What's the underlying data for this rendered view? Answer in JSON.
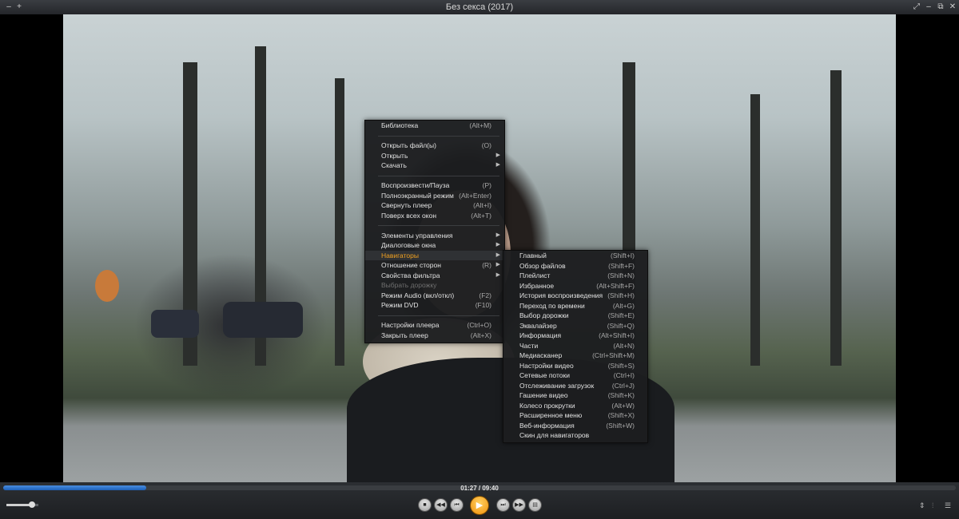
{
  "window": {
    "title": "Без секса (2017)",
    "left_buttons": [
      "–",
      "+"
    ],
    "right_buttons": [
      "⤢",
      "–",
      "⧉",
      "✕"
    ]
  },
  "main_menu": [
    {
      "label": "Библиотека",
      "shortcut": "(Alt+M)"
    },
    {
      "separator": true
    },
    {
      "label": "Открыть файл(ы)",
      "shortcut": "(O)"
    },
    {
      "label": "Открыть",
      "submenu": true
    },
    {
      "label": "Скачать",
      "submenu": true
    },
    {
      "separator": true
    },
    {
      "label": "Воспроизвести/Пауза",
      "shortcut": "(P)"
    },
    {
      "label": "Полноэкранный режим",
      "shortcut": "(Alt+Enter)"
    },
    {
      "label": "Свернуть плеер",
      "shortcut": "(Alt+I)"
    },
    {
      "label": "Поверх всех окон",
      "shortcut": "(Alt+T)"
    },
    {
      "separator": true
    },
    {
      "label": "Элементы управления",
      "submenu": true
    },
    {
      "label": "Диалоговые окна",
      "submenu": true
    },
    {
      "label": "Навигаторы",
      "submenu": true,
      "active": true
    },
    {
      "label": "Отношение сторон",
      "shortcut": "(R)",
      "submenu": true
    },
    {
      "label": "Свойства фильтра",
      "submenu": true
    },
    {
      "label": "Выбрать дорожку",
      "disabled": true
    },
    {
      "label": "Режим Audio (вкл/откл)",
      "shortcut": "(F2)"
    },
    {
      "label": "Режим DVD",
      "shortcut": "(F10)"
    },
    {
      "separator": true
    },
    {
      "label": "Настройки плеера",
      "shortcut": "(Ctrl+O)"
    },
    {
      "label": "Закрыть плеер",
      "shortcut": "(Alt+X)"
    }
  ],
  "navigators_submenu": [
    {
      "label": "Главный",
      "shortcut": "(Shift+I)"
    },
    {
      "label": "Обзор файлов",
      "shortcut": "(Shift+F)"
    },
    {
      "label": "Плейлист",
      "shortcut": "(Shift+N)"
    },
    {
      "label": "Избранное",
      "shortcut": "(Alt+Shift+F)"
    },
    {
      "label": "История воспроизведения",
      "shortcut": "(Shift+H)"
    },
    {
      "label": "Переход по времени",
      "shortcut": "(Alt+G)"
    },
    {
      "label": "Выбор дорожки",
      "shortcut": "(Shift+E)"
    },
    {
      "label": "Эквалайзер",
      "shortcut": "(Shift+Q)"
    },
    {
      "label": "Информация",
      "shortcut": "(Alt+Shift+I)"
    },
    {
      "label": "Части",
      "shortcut": "(Alt+N)"
    },
    {
      "label": "Медиасканер",
      "shortcut": "(Ctrl+Shift+M)"
    },
    {
      "label": "Настройки видео",
      "shortcut": "(Shift+S)"
    },
    {
      "label": "Сетевые потоки",
      "shortcut": "(Ctrl+I)"
    },
    {
      "label": "Отслеживание загрузок",
      "shortcut": "(Ctrl+J)"
    },
    {
      "label": "Гашение видео",
      "shortcut": "(Shift+K)"
    },
    {
      "label": "Колесо прокрутки",
      "shortcut": "(Alt+W)"
    },
    {
      "label": "Расширенное меню",
      "shortcut": "(Shift+X)"
    },
    {
      "label": "Веб-информация",
      "shortcut": "(Shift+W)"
    },
    {
      "label": "Скин для навигаторов",
      "shortcut": ""
    }
  ],
  "player": {
    "time": "01:27 / 09:40",
    "progress_fraction": 0.15,
    "volume_fraction": 0.8,
    "buttons": [
      {
        "name": "stop-button",
        "glyph": "■"
      },
      {
        "name": "rewind-button",
        "glyph": "◀◀"
      },
      {
        "name": "prev-button",
        "glyph": "⏮"
      },
      {
        "name": "play-button",
        "glyph": "▶"
      },
      {
        "name": "next-button",
        "glyph": "⏭"
      },
      {
        "name": "forward-button",
        "glyph": "▶▶"
      },
      {
        "name": "open-button",
        "glyph": "▤"
      }
    ],
    "right_icons": [
      "⇕",
      "⫶",
      "☰"
    ]
  },
  "colors": {
    "accent": "#f0a020",
    "seek": "#1c5fb8"
  }
}
